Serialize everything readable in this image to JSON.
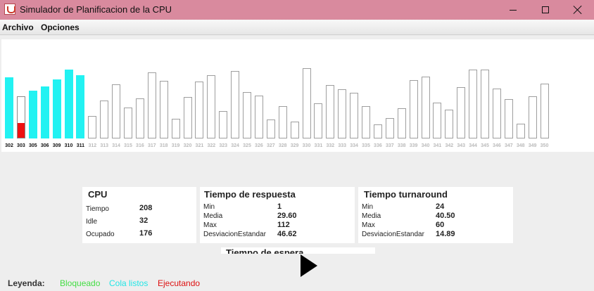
{
  "window": {
    "title": "Simulador de Planificacion de la CPU",
    "icon": "java-cup-icon",
    "controls": [
      "minimize-icon",
      "maximize-icon",
      "close-icon"
    ]
  },
  "menu": {
    "archivo": "Archivo",
    "opciones": "Opciones"
  },
  "colors": {
    "ready": "#22f2f2",
    "running": "#ee1111",
    "blocked_legend": "#44dd44",
    "ready_legend": "#22e6e6",
    "running_legend": "#dd1111"
  },
  "processes": [
    {
      "label": "302",
      "level": 0.71,
      "state": "ready"
    },
    {
      "label": "303",
      "level": 0.49,
      "state": "running",
      "progress": 0.17
    },
    {
      "label": "305",
      "level": 0.56,
      "state": "ready"
    },
    {
      "label": "306",
      "level": 0.61,
      "state": "ready"
    },
    {
      "label": "309",
      "level": 0.69,
      "state": "ready"
    },
    {
      "label": "310",
      "level": 0.8,
      "state": "ready"
    },
    {
      "label": "311",
      "level": 0.74,
      "state": "ready"
    },
    {
      "label": "312",
      "level": 0.26,
      "state": "idle"
    },
    {
      "label": "313",
      "level": 0.44,
      "state": "idle"
    },
    {
      "label": "314",
      "level": 0.63,
      "state": "idle"
    },
    {
      "label": "315",
      "level": 0.36,
      "state": "idle"
    },
    {
      "label": "316",
      "level": 0.47,
      "state": "idle"
    },
    {
      "label": "317",
      "level": 0.77,
      "state": "idle"
    },
    {
      "label": "318",
      "level": 0.67,
      "state": "idle"
    },
    {
      "label": "319",
      "level": 0.23,
      "state": "idle"
    },
    {
      "label": "320",
      "level": 0.48,
      "state": "idle"
    },
    {
      "label": "321",
      "level": 0.66,
      "state": "idle"
    },
    {
      "label": "322",
      "level": 0.74,
      "state": "idle"
    },
    {
      "label": "323",
      "level": 0.32,
      "state": "idle"
    },
    {
      "label": "324",
      "level": 0.79,
      "state": "idle"
    },
    {
      "label": "325",
      "level": 0.54,
      "state": "idle"
    },
    {
      "label": "326",
      "level": 0.5,
      "state": "idle"
    },
    {
      "label": "327",
      "level": 0.22,
      "state": "idle"
    },
    {
      "label": "328",
      "level": 0.38,
      "state": "idle"
    },
    {
      "label": "329",
      "level": 0.2,
      "state": "idle"
    },
    {
      "label": "330",
      "level": 0.82,
      "state": "idle"
    },
    {
      "label": "331",
      "level": 0.41,
      "state": "idle"
    },
    {
      "label": "332",
      "level": 0.62,
      "state": "idle"
    },
    {
      "label": "333",
      "level": 0.57,
      "state": "idle"
    },
    {
      "label": "334",
      "level": 0.53,
      "state": "idle"
    },
    {
      "label": "335",
      "level": 0.38,
      "state": "idle"
    },
    {
      "label": "336",
      "level": 0.16,
      "state": "idle"
    },
    {
      "label": "337",
      "level": 0.24,
      "state": "idle"
    },
    {
      "label": "338",
      "level": 0.35,
      "state": "idle"
    },
    {
      "label": "339",
      "level": 0.68,
      "state": "idle"
    },
    {
      "label": "340",
      "level": 0.72,
      "state": "idle"
    },
    {
      "label": "341",
      "level": 0.42,
      "state": "idle"
    },
    {
      "label": "342",
      "level": 0.34,
      "state": "idle"
    },
    {
      "label": "343",
      "level": 0.6,
      "state": "idle"
    },
    {
      "label": "344",
      "level": 0.8,
      "state": "idle"
    },
    {
      "label": "345",
      "level": 0.8,
      "state": "idle"
    },
    {
      "label": "346",
      "level": 0.58,
      "state": "idle"
    },
    {
      "label": "347",
      "level": 0.46,
      "state": "idle"
    },
    {
      "label": "348",
      "level": 0.17,
      "state": "idle"
    },
    {
      "label": "349",
      "level": 0.49,
      "state": "idle"
    },
    {
      "label": "350",
      "level": 0.64,
      "state": "idle"
    }
  ],
  "cpu": {
    "title": "CPU",
    "rows": [
      {
        "label": "Tiempo",
        "value": "208"
      },
      {
        "label": "Idle",
        "value": "32"
      },
      {
        "label": "Ocupado",
        "value": "176"
      }
    ]
  },
  "respuesta": {
    "title": "Tiempo de respuesta",
    "rows": [
      {
        "label": "Min",
        "value": "1"
      },
      {
        "label": "Media",
        "value": "29.60"
      },
      {
        "label": "Max",
        "value": "112"
      },
      {
        "label": "DesviacionEstandar",
        "value": "46.62"
      }
    ]
  },
  "turnaround": {
    "title": "Tiempo turnaround",
    "rows": [
      {
        "label": "Min",
        "value": "24"
      },
      {
        "label": "Media",
        "value": "40.50"
      },
      {
        "label": "Max",
        "value": "60"
      },
      {
        "label": "DesviacionEstandar",
        "value": "14.89"
      }
    ]
  },
  "espera": {
    "title": "Tiempo de espera"
  },
  "legend": {
    "title": "Leyenda:",
    "bloqueado": "Bloqueado",
    "cola": "Cola listos",
    "ejecutando": "Ejecutando"
  }
}
